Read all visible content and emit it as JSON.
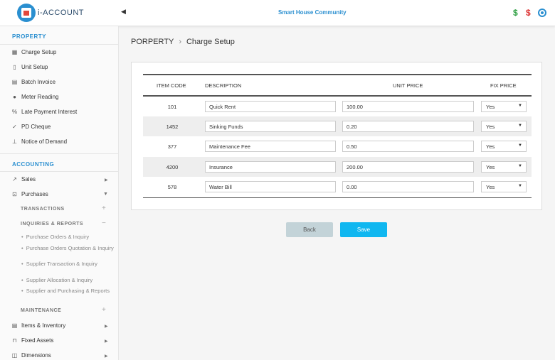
{
  "app": {
    "name": "i-ACCOUNT",
    "community": "Smart House Community"
  },
  "sidebar": {
    "property_title": "PROPERTY",
    "property_items": [
      {
        "label": "Charge Setup",
        "icon": "grid-icon"
      },
      {
        "label": "Unit Setup",
        "icon": "building-icon"
      },
      {
        "label": "Batch Invoice",
        "icon": "document-icon"
      },
      {
        "label": "Meter Reading",
        "icon": "drop-icon"
      },
      {
        "label": "Late Payment Interest",
        "icon": "percent-icon"
      },
      {
        "label": "PD Cheque",
        "icon": "check-icon"
      },
      {
        "label": "Notice of Demand",
        "icon": "pin-icon"
      }
    ],
    "accounting_title": "ACCOUNTING",
    "sales_label": "Sales",
    "purchases_label": "Purchases",
    "transactions_label": "TRANSACTIONS",
    "inquiries_label": "INQUIRIES & REPORTS",
    "inquiry_links": [
      "Purchase Orders & Inquiry",
      "Purchase Orders Quotation & Inquiry",
      "Supplier Transaction & Inquiry",
      "Supplier Allocation & Inquiry",
      "Supplier and Purchasing & Reports"
    ],
    "maintenance_label": "MAINTENANCE",
    "items_inventory_label": "Items & Inventory",
    "fixed_assets_label": "Fixed Assets",
    "dimensions_label": "Dimensions"
  },
  "breadcrumb": {
    "parent": "PORPERTY",
    "current": "Charge Setup"
  },
  "table": {
    "headers": {
      "code": "ITEM CODE",
      "description": "DESCRIPTION",
      "unit_price": "UNIT PRICE",
      "fix_price": "FIX PRICE"
    },
    "rows": [
      {
        "code": "101",
        "description": "Quick Rent",
        "unit_price": "100.00",
        "fix_price": "Yes"
      },
      {
        "code": "1452",
        "description": "Sinking Funds",
        "unit_price": "0.20",
        "fix_price": "Yes"
      },
      {
        "code": "377",
        "description": "Maintenance Fee",
        "unit_price": "0.50",
        "fix_price": "Yes"
      },
      {
        "code": "4200",
        "description": "Insurance",
        "unit_price": "200.00",
        "fix_price": "Yes"
      },
      {
        "code": "578",
        "description": "Water Bill",
        "unit_price": "0.00",
        "fix_price": "Yes"
      }
    ]
  },
  "buttons": {
    "back": "Back",
    "save": "Save"
  },
  "colors": {
    "accent": "#2a8fd0",
    "save": "#10b7f0",
    "back": "#c3d3d8"
  }
}
